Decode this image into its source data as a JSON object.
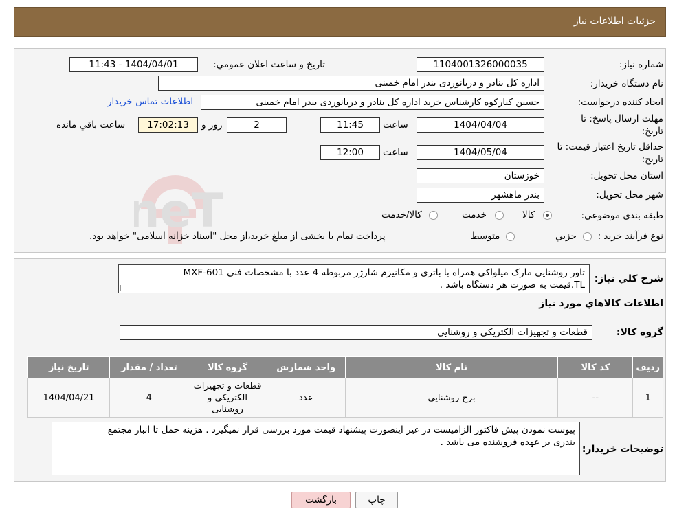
{
  "header": {
    "title": "جزئیات اطلاعات نیاز"
  },
  "form": {
    "need_number_label": "شماره نیاز:",
    "need_number": "1104001326000035",
    "announce_label": "تاریخ و ساعت اعلان عمومي:",
    "announce_value": "1404/04/01 - 11:43",
    "buyer_org_label": "نام دستگاه خریدار:",
    "buyer_org": "اداره کل بنادر و دریانوردی بندر امام خمینی",
    "requester_label": "ایجاد کننده درخواست:",
    "requester": "حسین کنارکوه کارشناس خرید اداره کل بنادر و دریانوردی بندر امام خمینی",
    "contact_link": "اطلاعات تماس خریدار",
    "deadline_label_1": "مهلت ارسال پاسخ: تا",
    "deadline_label_2": "تاریخ:",
    "deadline_date": "1404/04/04",
    "time_label": "ساعت",
    "deadline_time": "11:45",
    "days_value": "2",
    "days_label": "روز و",
    "remaining_time": "17:02:13",
    "remaining_label": "ساعت باقي مانده",
    "validity_label_1": "حداقل تاریخ اعتبار قیمت: تا",
    "validity_label_2": "تاریخ:",
    "validity_date": "1404/05/04",
    "validity_time": "12:00",
    "province_label": "استان محل تحویل:",
    "province": "خوزستان",
    "city_label": "شهر محل تحویل:",
    "city": "بندر ماهشهر",
    "category_label": "طبقه بندی موضوعی:",
    "category_options": [
      "کالا",
      "خدمت",
      "کالا/خدمت"
    ],
    "category_selected": "کالا",
    "process_label": "نوع فرآیند خرید :",
    "process_options": [
      "جزیي",
      "متوسط"
    ],
    "process_note": "پرداخت تمام یا بخشی از مبلغ خرید،از محل \"اسناد خزانه اسلامی\" خواهد بود."
  },
  "details": {
    "summary_label": "شرح کلي نیاز:",
    "summary_line1": "تاور روشنایی مارک میلواکی همراه با باتری و مکانیزم شارژر مربوطه 4 عدد با مشخصات فنی MXF-601",
    "summary_line2": "TL.قیمت به صورت هر دستگاه باشد .",
    "goods_info_title": "اطلاعات کالاهاي مورد نیاز",
    "goods_group_label": "گروه کالا:",
    "goods_group": "قطعات و تجهیزات الکتریکی و روشنایی",
    "table": {
      "headers": [
        "ردیف",
        "کد کالا",
        "نام کالا",
        "واحد شمارش",
        "گروه کالا",
        "تعداد / مقدار",
        "تاریخ نیاز"
      ],
      "rows": [
        {
          "row": "1",
          "code": "--",
          "name": "برج روشنایی",
          "unit": "عدد",
          "group_l1": "قطعات و تجهیزات",
          "group_l2": "الکتریکی و",
          "group_l3": "روشنایی",
          "qty": "4",
          "date": "1404/04/21"
        }
      ]
    },
    "notes_label": "توضیحات خریدار:",
    "notes_line1": "پیوست نمودن پیش فاکتور الزامیست در غیر اینصورت پیشنهاد قیمت مورد بررسی قرار نمیگیرد . هزینه حمل تا انبار مجتمع",
    "notes_line2": "بندری بر عهده فروشنده می باشد ."
  },
  "buttons": {
    "print": "چاپ",
    "back": "بازگشت"
  },
  "watermark": {
    "text": "AriaTender.neT"
  },
  "colors": {
    "header": "#8b6a41",
    "table_header": "#8b8b8b",
    "link": "#1a4fd6",
    "back_button": "#f7d3d3"
  }
}
